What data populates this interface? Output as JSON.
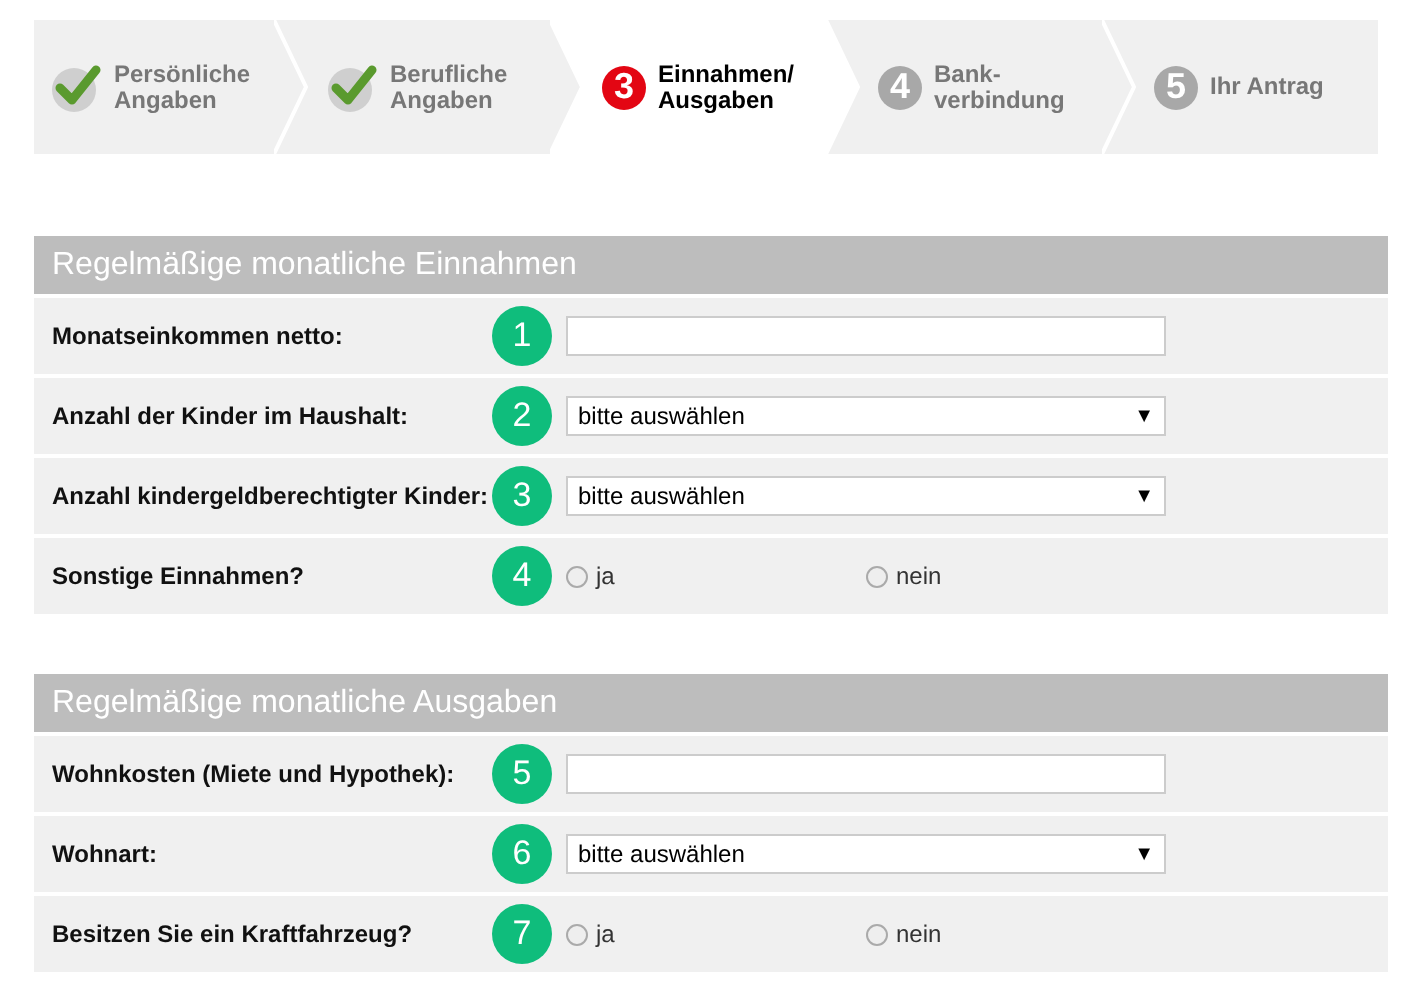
{
  "steps": [
    {
      "kind": "done",
      "selected": false,
      "lines": [
        "Persönliche",
        "Angaben"
      ]
    },
    {
      "kind": "done",
      "selected": false,
      "lines": [
        "Berufliche",
        "Angaben"
      ]
    },
    {
      "kind": "numbered",
      "selected": true,
      "number": "3",
      "lines": [
        "Einnahmen/",
        "Ausgaben"
      ]
    },
    {
      "kind": "numbered",
      "selected": false,
      "number": "4",
      "lines": [
        "Bank-",
        "verbindung"
      ]
    },
    {
      "kind": "numbered",
      "selected": false,
      "number": "5",
      "lines": [
        "Ihr Antrag"
      ]
    }
  ],
  "sections": [
    {
      "title": "Regelmäßige monatliche Einnahmen",
      "rows": [
        {
          "kind": "text",
          "label": "Monatseinkommen netto:",
          "badge": "1"
        },
        {
          "kind": "select",
          "label": "Anzahl der Kinder im Haushalt:",
          "badge": "2",
          "value": "bitte auswählen",
          "caret": "▼"
        },
        {
          "kind": "select",
          "label": "Anzahl kindergeldberechtigter Kinder:",
          "badge": "3",
          "value": "bitte auswählen",
          "caret": "▼"
        },
        {
          "kind": "radio",
          "label": "Sonstige Einnahmen?",
          "badge": "4",
          "options": [
            {
              "label": "ja",
              "selected": false
            },
            {
              "label": "nein",
              "selected": false
            }
          ]
        }
      ]
    },
    {
      "title": "Regelmäßige monatliche Ausgaben",
      "rows": [
        {
          "kind": "text",
          "label": "Wohnkosten (Miete und Hypothek):",
          "badge": "5"
        },
        {
          "kind": "select",
          "label": "Wohnart:",
          "badge": "6",
          "value": "bitte auswählen",
          "caret": "▼"
        },
        {
          "kind": "radio",
          "label": "Besitzen Sie ein Kraftfahrzeug?",
          "badge": "7",
          "options": [
            {
              "label": "ja",
              "selected": false
            },
            {
              "label": "nein",
              "selected": false
            }
          ]
        }
      ]
    }
  ]
}
